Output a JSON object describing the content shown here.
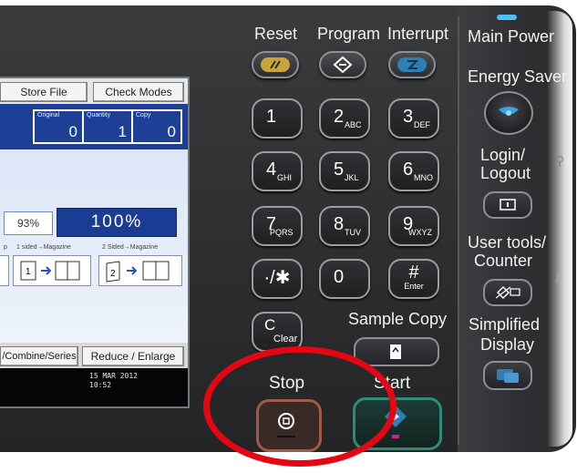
{
  "screen": {
    "store_file": "Store File",
    "check_modes": "Check Modes",
    "counters": [
      {
        "label": "Original",
        "value": "0"
      },
      {
        "label": "Quantity",
        "value": "1"
      },
      {
        "label": "Copy",
        "value": "0"
      }
    ],
    "ratio_small": "93%",
    "ratio_large": "100%",
    "magazine_left_label": "p",
    "magazine_labels": [
      "1 sided→Magazine",
      "2 Sided→Magazine"
    ],
    "combine_series": "/Combine/Series",
    "reduce_enlarge": "Reduce / Enlarge",
    "date": "15 MAR  2012",
    "time": "10:52"
  },
  "top_labels": {
    "reset": "Reset",
    "program": "Program",
    "interrupt": "Interrupt"
  },
  "keypad": [
    {
      "main": "1",
      "sub": ""
    },
    {
      "main": "2",
      "sub": "ABC"
    },
    {
      "main": "3",
      "sub": "DEF"
    },
    {
      "main": "4",
      "sub": "GHI"
    },
    {
      "main": "5",
      "sub": "JKL"
    },
    {
      "main": "6",
      "sub": "MNO"
    },
    {
      "main": "7",
      "sub": "PQRS"
    },
    {
      "main": "8",
      "sub": "TUV"
    },
    {
      "main": "9",
      "sub": "WXYZ"
    },
    {
      "main": "·/✱",
      "sub": ""
    },
    {
      "main": "0",
      "sub": ""
    },
    {
      "main": "#",
      "sub": "Enter"
    }
  ],
  "clear_key": {
    "main": "C",
    "sub": "Clear"
  },
  "sample_copy": "Sample Copy",
  "stop": "Stop",
  "start": "Start",
  "right_labels": {
    "main_power": "Main Power",
    "energy_saver": "Energy Saver",
    "login_logout_1": "Login/",
    "login_logout_2": "Logout",
    "user_tools_1": "User tools/",
    "user_tools_2": "Counter",
    "simplified_1": "Simplified",
    "simplified_2": "Display"
  },
  "colors": {
    "panel": "#2c2d2f",
    "highlight_circle": "#e50613",
    "start_green": "#2d8c76",
    "stop_red": "#a25a48",
    "reset_yellow": "#c9a43a",
    "interrupt_blue": "#2f7fb6",
    "energy_blue": "#3aa0e0",
    "screen_blue": "#1d3f96"
  }
}
